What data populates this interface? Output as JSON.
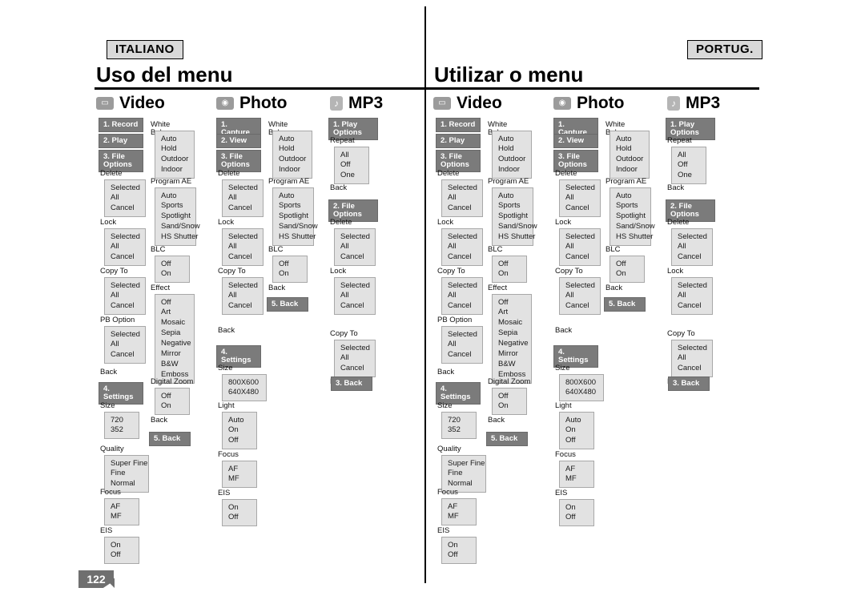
{
  "page": {
    "number": "122"
  },
  "columns": [
    {
      "lang_tag": "ITALIANO",
      "title": "Uso del menu",
      "sections": [
        {
          "icon": "video-camera-icon",
          "label": "Video"
        },
        {
          "icon": "photo-camera-icon",
          "label": "Photo"
        },
        {
          "icon": "music-note-icon",
          "label": "MP3"
        }
      ],
      "video_tree": {
        "headers": [
          "1. Record",
          "2. Play",
          "3. File Options",
          "4. Settings",
          "5. Back"
        ],
        "groups": [
          {
            "label": "Delete",
            "items": [
              "Selected",
              "All",
              "Cancel"
            ]
          },
          {
            "label": "Lock",
            "items": [
              "Selected",
              "All",
              "Cancel"
            ]
          },
          {
            "label": "Copy To",
            "items": [
              "Selected",
              "All",
              "Cancel"
            ]
          },
          {
            "label": "PB Option",
            "items": [
              "Selected",
              "All",
              "Cancel"
            ]
          },
          {
            "label": "Back",
            "items": []
          },
          {
            "label": "Size",
            "items": [
              "720",
              "352"
            ]
          },
          {
            "label": "Quality",
            "items": [
              "Super Fine",
              "Fine",
              "Normal"
            ]
          },
          {
            "label": "Focus",
            "items": [
              "AF",
              "MF"
            ]
          },
          {
            "label": "EIS",
            "items": [
              "On",
              "Off"
            ]
          }
        ]
      },
      "photo_tree": {
        "headers": [
          "1. Capture",
          "2. View",
          "3. File Options",
          "4. Settings",
          "5. Back"
        ],
        "groups": [
          {
            "label": "Delete",
            "items": [
              "Selected",
              "All",
              "Cancel"
            ]
          },
          {
            "label": "Lock",
            "items": [
              "Selected",
              "All",
              "Cancel"
            ]
          },
          {
            "label": "Copy To",
            "items": [
              "Selected",
              "All",
              "Cancel"
            ]
          },
          {
            "label": "Back",
            "items": []
          },
          {
            "label": "Size",
            "items": [
              "800X600",
              "640X480"
            ]
          },
          {
            "label": "Light",
            "items": [
              "Auto",
              "On",
              "Off"
            ]
          },
          {
            "label": "Focus",
            "items": [
              "AF",
              "MF"
            ]
          },
          {
            "label": "EIS",
            "items": [
              "On",
              "Off"
            ]
          }
        ],
        "right_column": [
          {
            "label": "White Balance",
            "items": [
              "Auto",
              "Hold",
              "Outdoor",
              "Indoor"
            ]
          },
          {
            "label": "Program AE",
            "items": [
              "Auto",
              "Sports",
              "Spotlight",
              "Sand/Snow",
              "HS Shutter"
            ]
          },
          {
            "label": "BLC",
            "items": [
              "Off",
              "On"
            ]
          },
          {
            "label": "Effect",
            "items": [
              "Off",
              "Art",
              "Mosaic",
              "Sepia",
              "Negative",
              "Mirror",
              "B&W",
              "Emboss"
            ]
          },
          {
            "label": "Digital Zoom",
            "items": [
              "Off",
              "On"
            ]
          },
          {
            "label": "Back",
            "items": []
          }
        ]
      },
      "mp3_tree": {
        "headers": [
          "1. Play Options",
          "2. File Options",
          "3. Back"
        ],
        "groups": [
          {
            "label": "Repeat",
            "items": [
              "All",
              "Off",
              "One"
            ]
          },
          {
            "label": "Back",
            "items": []
          },
          {
            "label": "Delete",
            "items": [
              "Selected",
              "All",
              "Cancel"
            ]
          },
          {
            "label": "Lock",
            "items": [
              "Selected",
              "All",
              "Cancel"
            ]
          },
          {
            "label": "Copy To",
            "items": [
              "Selected",
              "All",
              "Cancel"
            ]
          },
          {
            "label": "Back",
            "items": []
          }
        ]
      }
    },
    {
      "lang_tag": "PORTUG.",
      "title": "Utilizar o menu",
      "sections": [
        {
          "icon": "video-camera-icon",
          "label": "Video"
        },
        {
          "icon": "photo-camera-icon",
          "label": "Photo"
        },
        {
          "icon": "music-note-icon",
          "label": "MP3"
        }
      ]
    }
  ]
}
